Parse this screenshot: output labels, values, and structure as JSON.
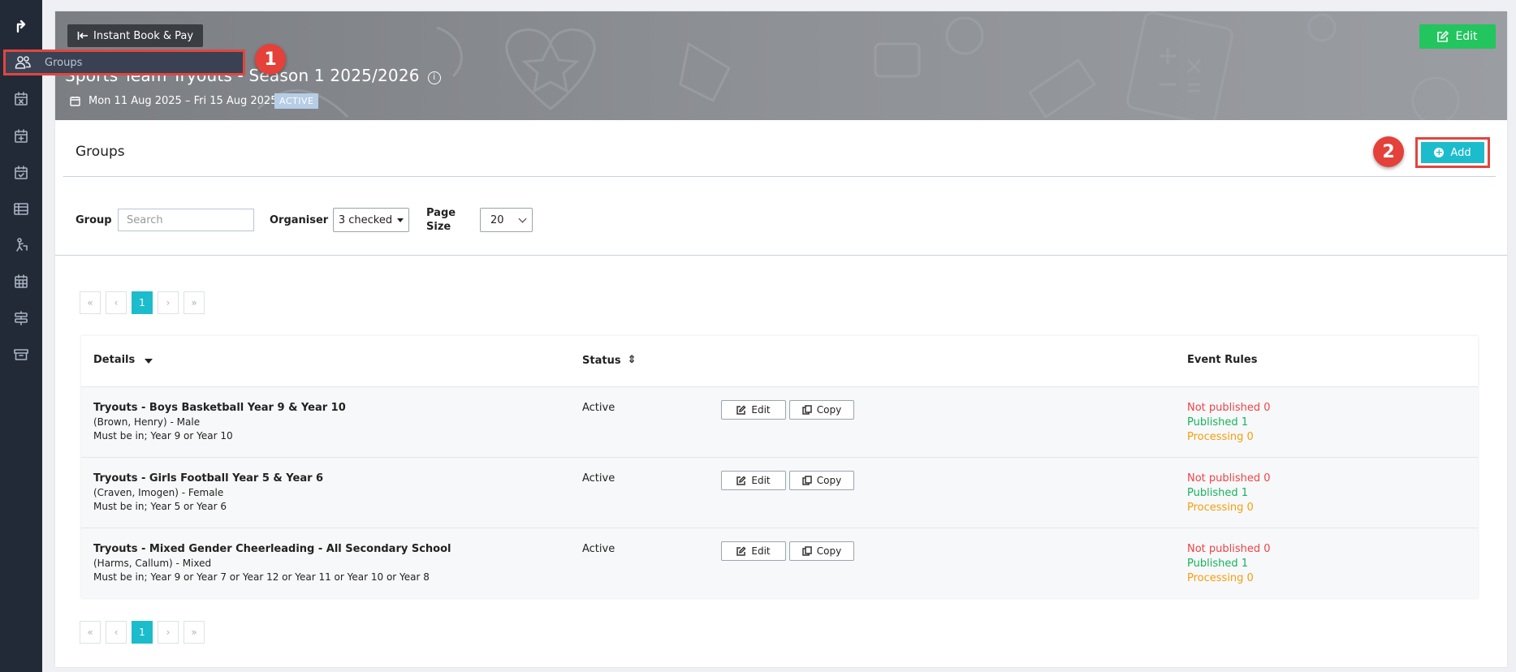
{
  "flyout": {
    "label": "Groups"
  },
  "callouts": [
    "1",
    "2"
  ],
  "banner": {
    "back_label": "Instant Book & Pay",
    "title": "Sports Team Tryouts - Season 1 2025/2026",
    "info_icon": "i",
    "date": "Mon 11 Aug 2025 – Fri 15 Aug 2025",
    "badge": "ACTIVE",
    "edit_label": "Edit"
  },
  "section": {
    "title": "Groups",
    "add_label": "Add"
  },
  "filters": {
    "group_label": "Group",
    "search_placeholder": "Search",
    "organiser_label": "Organiser",
    "organiser_value": "3 checked",
    "pagesize_label_1": "Page",
    "pagesize_label_2": "Size",
    "pagesize_value": "20"
  },
  "pager": [
    "«",
    "‹",
    "1",
    "›",
    "»"
  ],
  "table": {
    "headers": {
      "details": "Details",
      "status": "Status",
      "rules": "Event Rules"
    },
    "edit_label": "Edit",
    "copy_label": "Copy",
    "rows": [
      {
        "name": "Tryouts - Boys Basketball Year 9 & Year 10",
        "organiser": "(Brown, Henry) - Male",
        "eligibility": "Must be in; Year 9 or Year 10",
        "status": "Active",
        "not_published": "Not published 0",
        "published": "Published 1",
        "processing": "Processing 0"
      },
      {
        "name": "Tryouts - Girls Football Year 5 & Year 6",
        "organiser": "(Craven, Imogen) - Female",
        "eligibility": "Must be in; Year 5 or Year 6",
        "status": "Active",
        "not_published": "Not published 0",
        "published": "Published 1",
        "processing": "Processing 0"
      },
      {
        "name": "Tryouts - Mixed Gender Cheerleading - All Secondary School",
        "organiser": "(Harms, Callum) - Mixed",
        "eligibility": "Must be in; Year 9 or Year 7 or Year 12 or Year 11 or Year 10 or Year 8",
        "status": "Active",
        "not_published": "Not published 0",
        "published": "Published 1",
        "processing": "Processing 0"
      }
    ]
  },
  "colors": {
    "sidebar": "#232a37",
    "accent": "#1cbccc",
    "edit_green": "#22c55e",
    "callout_red": "#e3413a",
    "not_published": "#ef4444",
    "published": "#16b35b",
    "processing": "#f59e0b"
  }
}
